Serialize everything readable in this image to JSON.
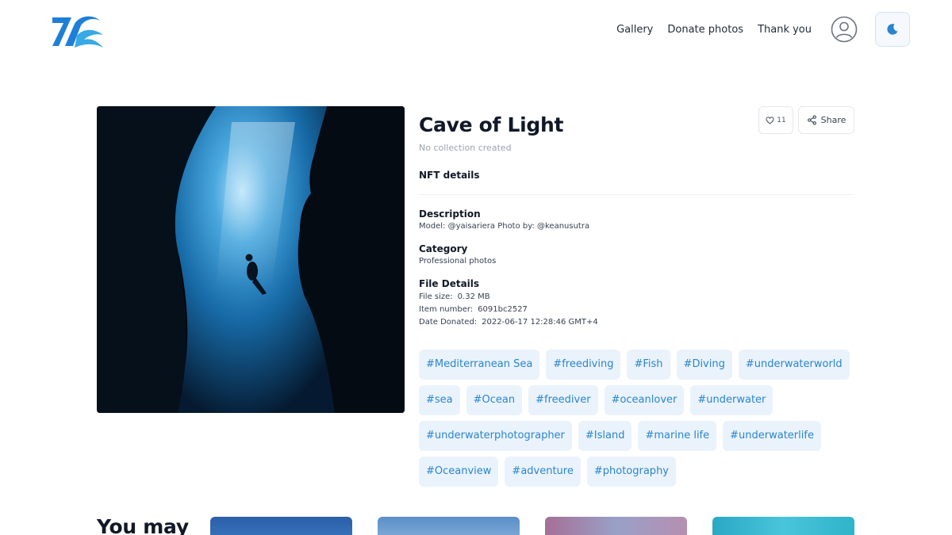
{
  "header": {
    "nav": [
      {
        "label": "Gallery"
      },
      {
        "label": "Donate photos"
      },
      {
        "label": "Thank you"
      }
    ],
    "icons": {
      "logo": "wave-logo",
      "profile": "user-circle-icon",
      "theme": "moon-icon"
    }
  },
  "photo": {
    "title": "Cave of Light",
    "collection": "No collection created",
    "likes": "11",
    "share_label": "Share",
    "nft_heading": "NFT details",
    "description": {
      "heading": "Description",
      "text": "Model: @yaisariera Photo by: @keanusutra"
    },
    "category": {
      "heading": "Category",
      "text": "Professional photos"
    },
    "file_details": {
      "heading": "File Details",
      "rows": [
        {
          "label": "File size:",
          "value": "0.32 MB"
        },
        {
          "label": "Item number:",
          "value": "6091bc2527"
        },
        {
          "label": "Date Donated:",
          "value": "2022-06-17 12:28:46 GMT+4"
        }
      ]
    },
    "tag_rows": [
      [
        "#Mediterranean Sea",
        "#freediving",
        "#Fish",
        "#Diving",
        "#underwaterworld"
      ],
      [
        "#sea",
        "#Ocean",
        "#freediver",
        "#oceanlover",
        "#underwater"
      ],
      [
        "#underwaterphotographer",
        "#Island",
        "#marine life",
        "#underwaterlife"
      ],
      [
        "#Oceanview",
        "#adventure",
        "#photography"
      ]
    ]
  },
  "related": {
    "heading": "You may"
  },
  "colors": {
    "accent": "#2a85cd",
    "tag_bg": "#eaf3fc",
    "logo_blue": "#1e7fd8"
  }
}
